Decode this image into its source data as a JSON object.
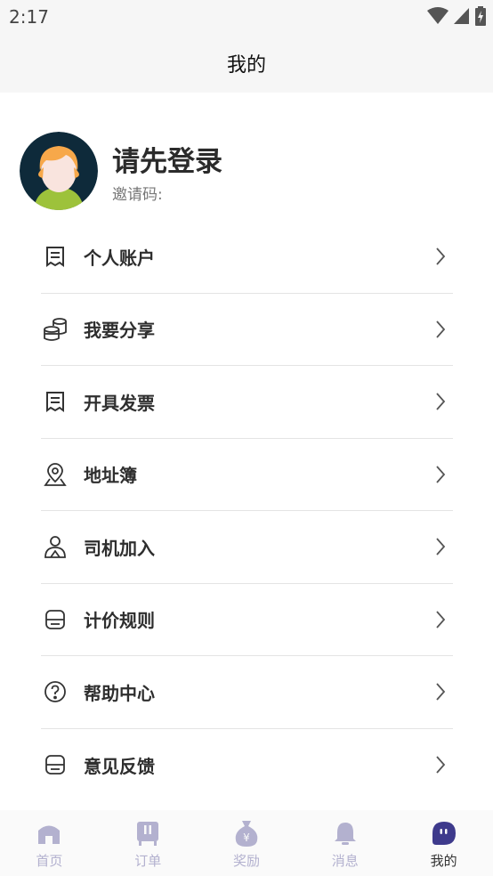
{
  "status_bar": {
    "time": "2:17"
  },
  "header": {
    "title": "我的"
  },
  "profile": {
    "title": "请先登录",
    "invite_label": "邀请码:"
  },
  "menu": [
    {
      "label": "个人账户",
      "icon": "receipt-icon"
    },
    {
      "label": "我要分享",
      "icon": "coins-icon"
    },
    {
      "label": "开具发票",
      "icon": "invoice-icon"
    },
    {
      "label": "地址簿",
      "icon": "location-pin-icon"
    },
    {
      "label": "司机加入",
      "icon": "driver-icon"
    },
    {
      "label": "计价规则",
      "icon": "pricing-icon"
    },
    {
      "label": "帮助中心",
      "icon": "help-icon"
    },
    {
      "label": "意见反馈",
      "icon": "feedback-icon"
    }
  ],
  "tabs": [
    {
      "label": "首页",
      "icon": "home-icon"
    },
    {
      "label": "订单",
      "icon": "order-icon"
    },
    {
      "label": "奖励",
      "icon": "reward-bag-icon"
    },
    {
      "label": "消息",
      "icon": "bell-icon"
    },
    {
      "label": "我的",
      "icon": "profile-icon",
      "active": true
    }
  ],
  "colors": {
    "tab_inactive": "#b3b1cf",
    "tab_active": "#3e3a8c",
    "text_primary": "#2e2e2e"
  }
}
